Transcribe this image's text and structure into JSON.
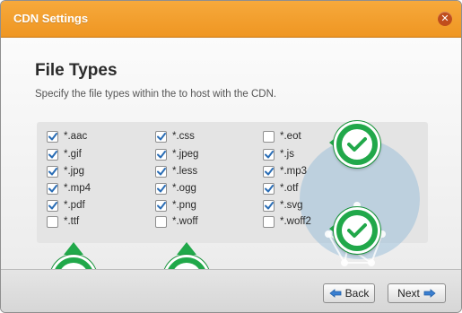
{
  "window": {
    "title": "CDN Settings",
    "close_icon": "close-icon"
  },
  "content": {
    "heading": "File Types",
    "subtitle": "Specify the file types within the to host with the CDN."
  },
  "file_types": {
    "col1": [
      {
        "label": "*.aac",
        "checked": true
      },
      {
        "label": "*.gif",
        "checked": true
      },
      {
        "label": "*.jpg",
        "checked": true
      },
      {
        "label": "*.mp4",
        "checked": true
      },
      {
        "label": "*.pdf",
        "checked": true
      },
      {
        "label": "*.ttf",
        "checked": false
      }
    ],
    "col2": [
      {
        "label": "*.css",
        "checked": true
      },
      {
        "label": "*.jpeg",
        "checked": true
      },
      {
        "label": "*.less",
        "checked": true
      },
      {
        "label": "*.ogg",
        "checked": true
      },
      {
        "label": "*.png",
        "checked": true
      },
      {
        "label": "*.woff",
        "checked": false
      }
    ],
    "col3": [
      {
        "label": "*.eot",
        "checked": false
      },
      {
        "label": "*.js",
        "checked": true
      },
      {
        "label": "*.mp3",
        "checked": true
      },
      {
        "label": "*.otf",
        "checked": true
      },
      {
        "label": "*.svg",
        "checked": true
      },
      {
        "label": "*.woff2",
        "checked": false
      }
    ]
  },
  "footer": {
    "back_label": "Back",
    "next_label": "Next"
  },
  "colors": {
    "titlebar": "#ef9622",
    "badge_green": "#21a84a",
    "check_blue": "#2a6db5"
  },
  "icons": {
    "badge": "green-checkmark-icon",
    "back": "arrow-left-icon",
    "next": "arrow-right-icon"
  }
}
